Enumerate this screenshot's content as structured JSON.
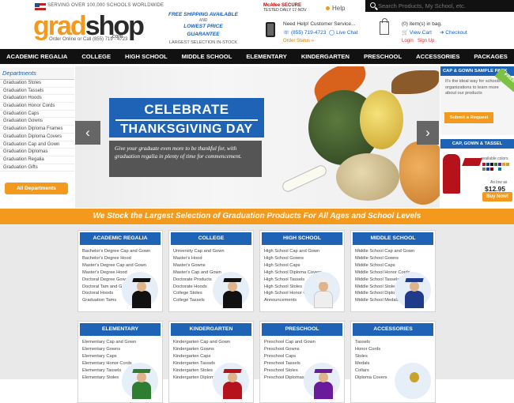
{
  "header": {
    "serving": "SERVING OVER 100,000 SCHOOLS WORLDWIDE",
    "logo_grad": "grad",
    "logo_shop": "shop",
    "logo_com": ".com",
    "tagline": "Order Online or Call (855) 719 - 4723",
    "promo1": "FREE SHIPPING AVAILABLE",
    "promo_and": "AND",
    "promo2": "LOWEST PRICE GUARANTEE",
    "promo3": "LARGEST SELECTION IN-STOCK",
    "mcafee": "McAfee SECURE",
    "mcafee_tested": "TESTED DAILY  17-NOV",
    "help": "Help",
    "search_placeholder": "Search Products, My School, etc.",
    "need_help": "Need Help! Customer Service...",
    "phone": "(855) 719-4723",
    "live_chat": "Live Chat",
    "order_status": "Order Status »",
    "cart_count": "(0) item(s) in bag.",
    "view_cart": "View Cart",
    "checkout": "Checkout",
    "login": "Login",
    "signup": "Sign Up"
  },
  "nav": [
    "ACADEMIC REGALIA",
    "COLLEGE",
    "HIGH SCHOOL",
    "MIDDLE SCHOOL",
    "ELEMENTARY",
    "KINDERGARTEN",
    "PRESCHOOL",
    "ACCESSORIES",
    "PACKAGES"
  ],
  "departments": {
    "title": "Departments",
    "items": [
      "Graduation Stoles",
      "Graduation Tassels",
      "Graduation Hoods",
      "Graduation Honor Cords",
      "Graduation Caps",
      "Graduation Gowns",
      "Graduation Diploma Frames",
      "Graduation Diploma Covers",
      "Graduation Cap and Gown",
      "Graduation Diplomas",
      "Graduation Regalia",
      "Graduation Gifts"
    ],
    "all_button": "All Departments"
  },
  "hero": {
    "line1": "CELEBRATE",
    "line2": "THANKSGIVING DAY",
    "sub": "Give your graduate even more to be thankful for, with graduation regalia in plenty of time for commencement.",
    "prev": "‹",
    "next": "›"
  },
  "right": {
    "sample_title": "CAP & GOWN SAMPLE PACK",
    "sample_body": "It's the ideal way for schools and organizations to learn more about our products",
    "free": "FREE",
    "request": "Submit a Request",
    "capgown_title": "CAP, GOWN & TASSEL",
    "available": "available colors",
    "as_low": "As low as",
    "price": "$12.95",
    "buy": "Buy Now!",
    "swatch_colors": [
      "#b5121b",
      "#1e3c8a",
      "#111111",
      "#2e7d32",
      "#6a1b9a",
      "#f39a1e",
      "#c9a22a",
      "#777777",
      "#0d47a1",
      "#8b0000",
      "#ffffff",
      "#00838f"
    ]
  },
  "banner": "We Stock the Largest Selection of Graduation Products For All Ages and School Levels",
  "categories": [
    {
      "title": "ACADEMIC REGALIA",
      "items": [
        "Bachelor's Degree Cap and Gown",
        "Bachelor's Degree Hood",
        "Master's Degree Cap and Gown",
        "Master's Degree Hood",
        "Doctoral Degree Gowns",
        "Doctoral Tam and Gown",
        "Doctoral Hoods",
        "Graduation Tams"
      ]
    },
    {
      "title": "COLLEGE",
      "items": [
        "University Cap and Gown",
        "Master's Hood",
        "Master's Gowns",
        "Master's Cap and Gown",
        "Doctorate Products",
        "Doctorate Hoods",
        "College Stoles",
        "College Tassels"
      ]
    },
    {
      "title": "HIGH SCHOOL",
      "items": [
        "High School Cap and Gown",
        "High School Gowns",
        "High School Caps",
        "High School Diploma Covers",
        "High School Tassels",
        "High School Stoles",
        "High School Honor Cords",
        "Announcements"
      ]
    },
    {
      "title": "MIDDLE SCHOOL",
      "items": [
        "Middle School Cap and Gown",
        "Middle School Gowns",
        "Middle School Caps",
        "Middle School Honor Cords",
        "Middle School Tassels",
        "Middle School Stoles",
        "Middle School Diplomas",
        "Middle School Medals"
      ]
    },
    {
      "title": "ELEMENTARY",
      "items": [
        "Elementary Cap and Gown",
        "Elementary Gowns",
        "Elementary Caps",
        "Elementary Honor Cords",
        "Elementary Tassels",
        "Elementary Stoles"
      ]
    },
    {
      "title": "KINDERGARTEN",
      "items": [
        "Kindergarten Cap and Gown",
        "Kindergarten Gowns",
        "Kindergarten Caps",
        "Kindergarten Tassels",
        "Kindergarten Stoles",
        "Kindergarten Diplomas"
      ]
    },
    {
      "title": "PRESCHOOL",
      "items": [
        "Preschool Cap and Gown",
        "Preschool Gowns",
        "Preschool Caps",
        "Preschool Tassels",
        "Preschool Stoles",
        "Preschool Diplomas"
      ]
    },
    {
      "title": "ACCESSORIES",
      "items": [
        "Tassels",
        "Honor Cords",
        "Stoles",
        "Medals",
        "Collars",
        "Diploma Covers"
      ]
    }
  ]
}
